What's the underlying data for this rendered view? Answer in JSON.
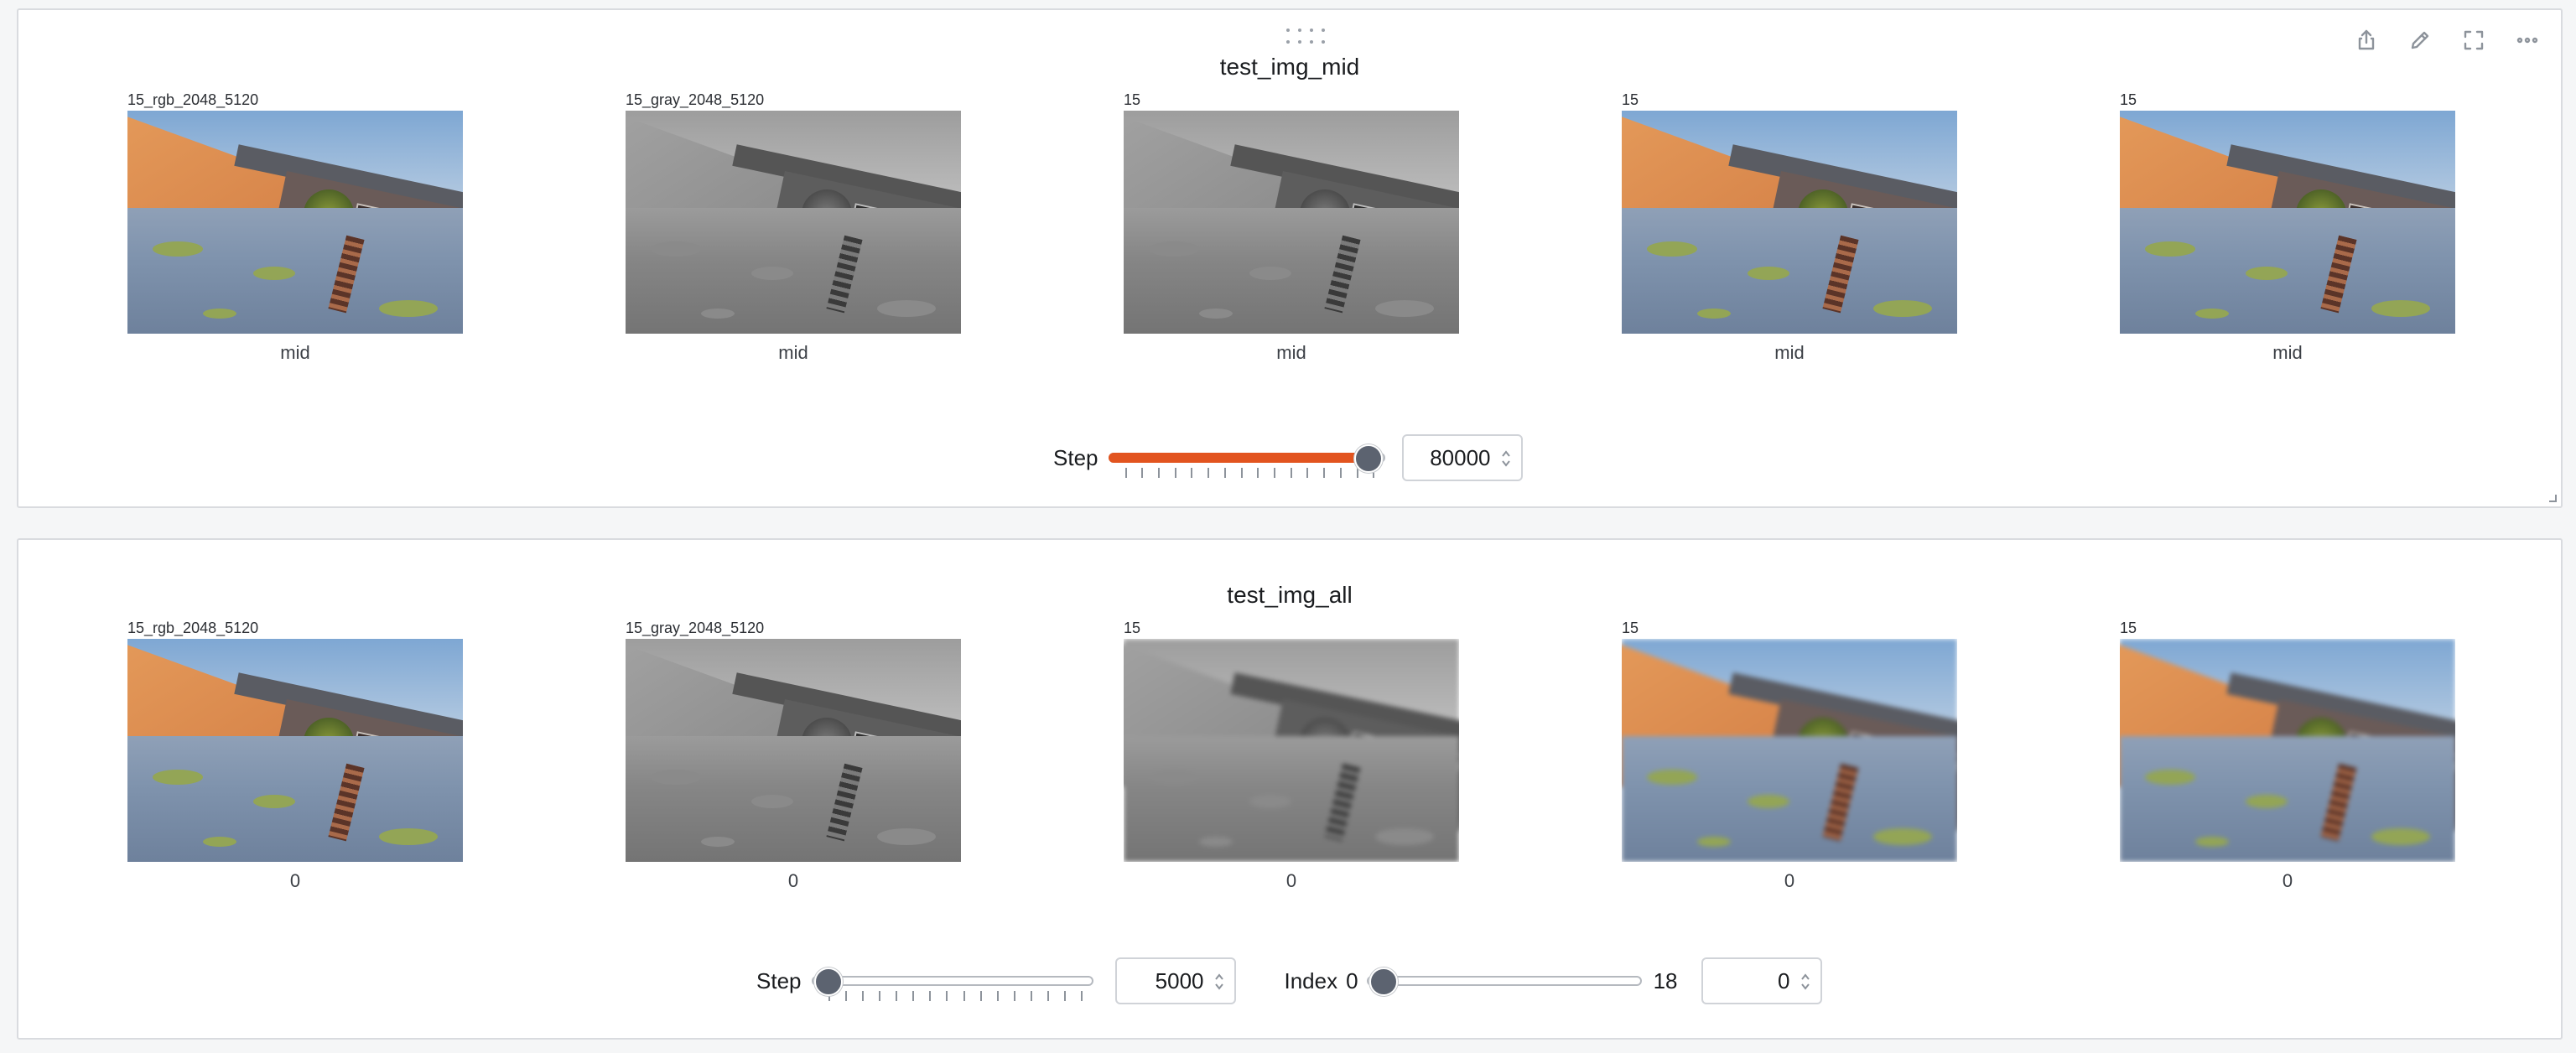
{
  "panels": {
    "mid": {
      "title": "test_img_mid",
      "images": [
        {
          "caption_top": "15_rgb_2048_5120",
          "caption_bottom": "mid",
          "style": "rgb"
        },
        {
          "caption_top": "15_gray_2048_5120",
          "caption_bottom": "mid",
          "style": "gray"
        },
        {
          "caption_top": "15",
          "caption_bottom": "mid",
          "style": "gray"
        },
        {
          "caption_top": "15",
          "caption_bottom": "mid",
          "style": "rgb"
        },
        {
          "caption_top": "15",
          "caption_bottom": "mid",
          "style": "rgb"
        }
      ],
      "step": {
        "label": "Step",
        "value": "80000",
        "fraction": 1.0
      }
    },
    "all": {
      "title": "test_img_all",
      "images": [
        {
          "caption_top": "15_rgb_2048_5120",
          "caption_bottom": "0",
          "style": "rgb"
        },
        {
          "caption_top": "15_gray_2048_5120",
          "caption_bottom": "0",
          "style": "gray"
        },
        {
          "caption_top": "15",
          "caption_bottom": "0",
          "style": "gray-blur"
        },
        {
          "caption_top": "15",
          "caption_bottom": "0",
          "style": "rgb-blur"
        },
        {
          "caption_top": "15",
          "caption_bottom": "0",
          "style": "rgb-blur"
        }
      ],
      "step": {
        "label": "Step",
        "value": "5000",
        "fraction": 0.0
      },
      "index": {
        "label": "Index",
        "min": "0",
        "max": "18",
        "value": "0",
        "fraction": 0.0
      }
    }
  },
  "toolbar_icons": [
    "share-icon",
    "edit-icon",
    "fullscreen-icon",
    "more-options-icon"
  ],
  "colors": {
    "accent": "#e2541f",
    "knob": "#5c6370",
    "border": "#d9dbdf"
  }
}
